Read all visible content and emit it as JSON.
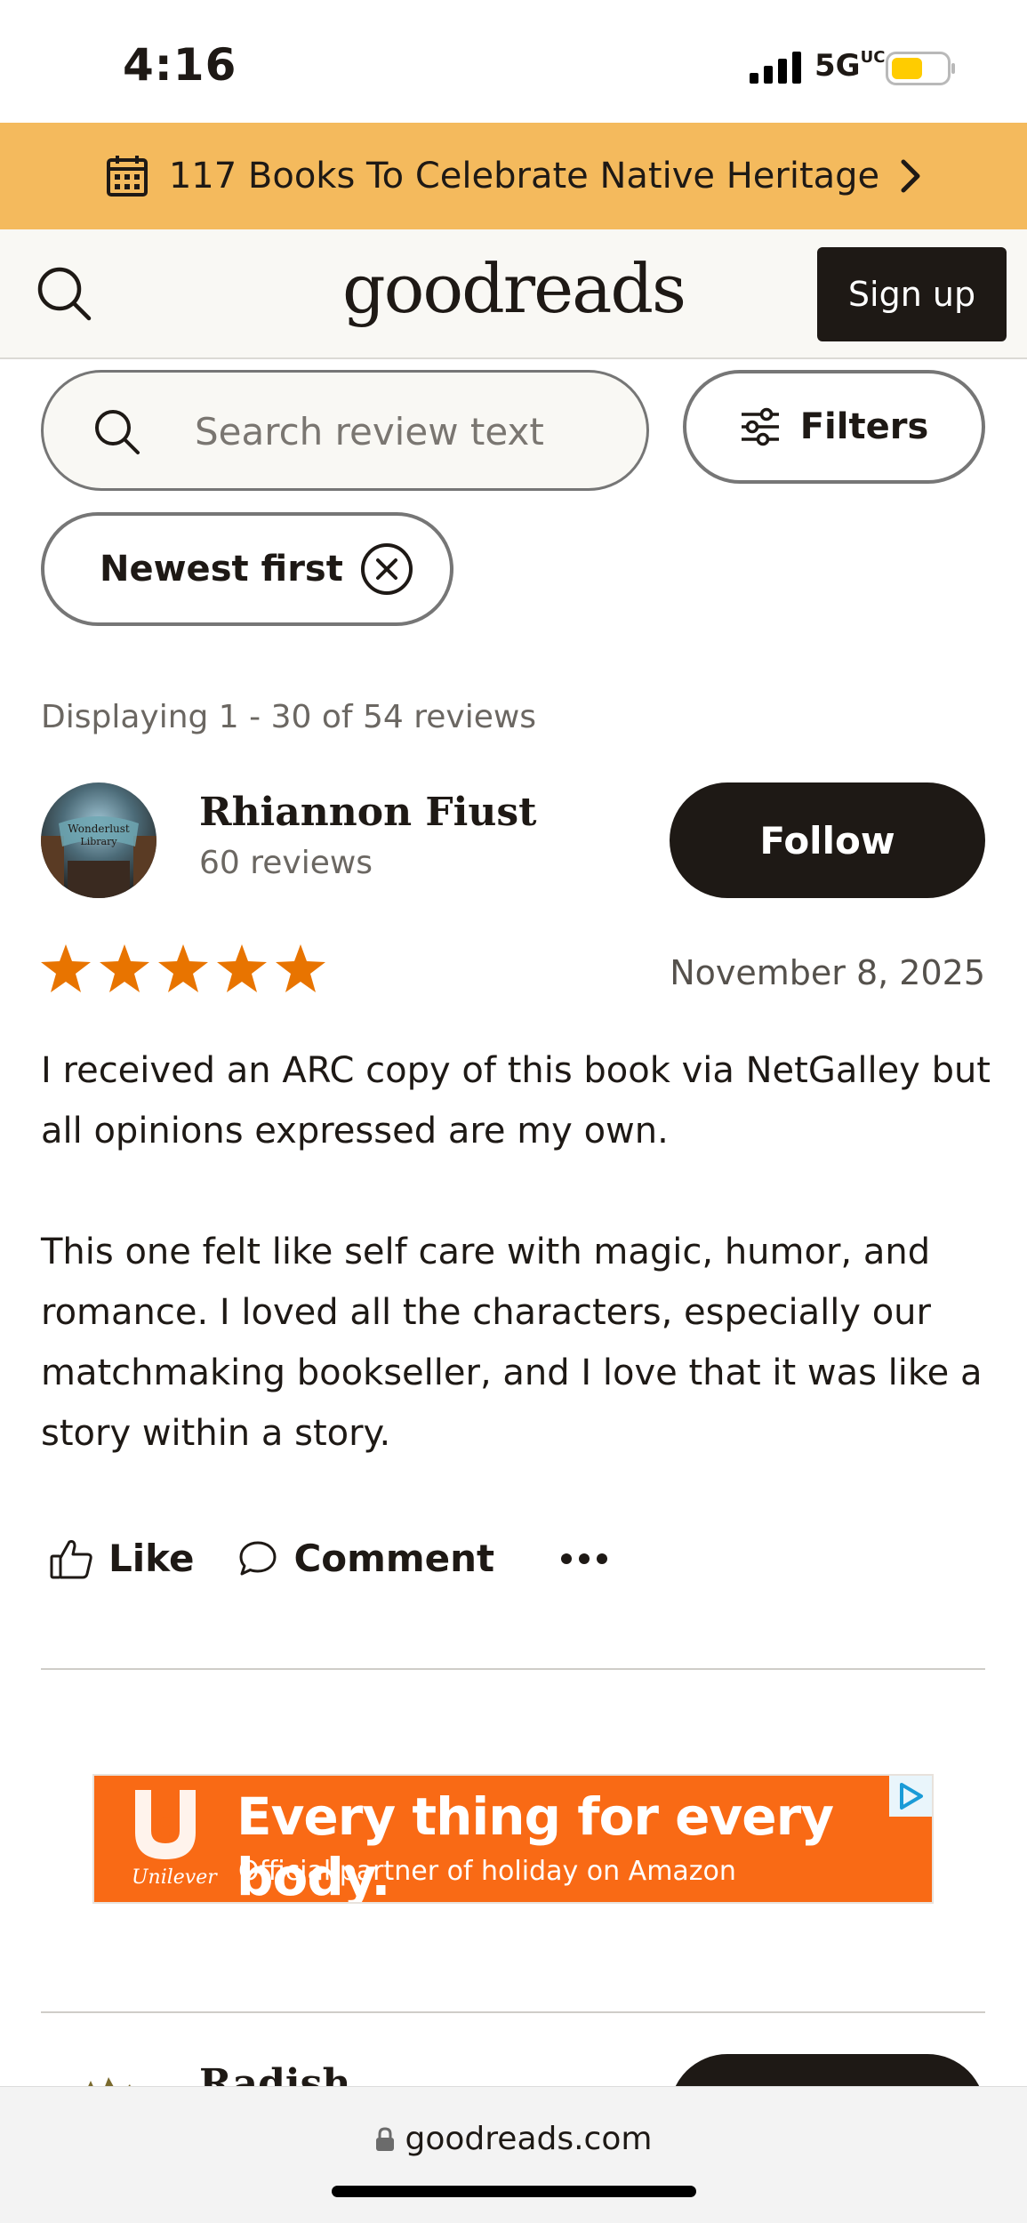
{
  "status_bar": {
    "time": "4:16",
    "network": "5G",
    "network_sup": "UC",
    "battery_color": "#ffcc00"
  },
  "promo": {
    "text": "117 Books To Celebrate Native Heritage",
    "background": "#f4ba5d"
  },
  "header": {
    "logo": "goodreads",
    "signup_label": "Sign up"
  },
  "search": {
    "placeholder": "Search review text",
    "filters_label": "Filters"
  },
  "sort": {
    "label": "Newest first"
  },
  "reviews_summary": "Displaying 1 - 30 of 54 reviews",
  "review": {
    "reviewer_name": "Rhiannon Fiust",
    "reviewer_reviews": "60 reviews",
    "avatar_text_line1": "Wonderlust",
    "avatar_text_line2": "Library",
    "follow_label": "Follow",
    "rating": 5,
    "star_color": "#e87400",
    "date": "November 8, 2025",
    "paragraphs": [
      "I received an ARC copy of this book via NetGalley but all opinions expressed are my own.",
      "This one felt like self care with magic, humor, and romance. I loved all the characters, especially our matchmaking bookseller, and I love that it was like a story within a story."
    ],
    "like_label": "Like",
    "comment_label": "Comment"
  },
  "ad": {
    "headline": "Every thing for every body.",
    "subline": "Official partner of holiday on Amazon",
    "brand": "Unilever",
    "background": "#f96a15"
  },
  "next_review": {
    "reviewer_name": "Radish"
  },
  "url_bar": {
    "domain": "goodreads.com"
  }
}
